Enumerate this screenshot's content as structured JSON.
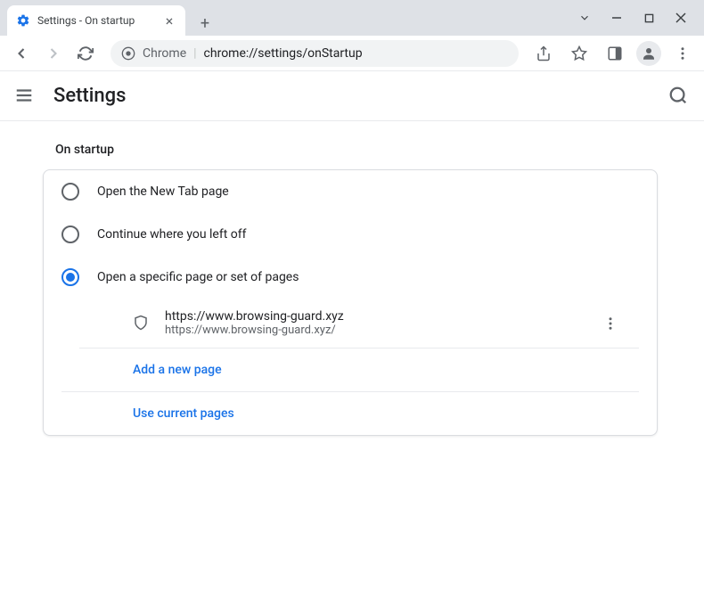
{
  "window": {
    "tab_title": "Settings - On startup"
  },
  "omnibox": {
    "scheme_label": "Chrome",
    "url": "chrome://settings/onStartup"
  },
  "header": {
    "title": "Settings"
  },
  "section": {
    "label": "On startup"
  },
  "options": [
    {
      "label": "Open the New Tab page",
      "selected": false
    },
    {
      "label": "Continue where you left off",
      "selected": false
    },
    {
      "label": "Open a specific page or set of pages",
      "selected": true
    }
  ],
  "startup_pages": [
    {
      "title": "https://www.browsing-guard.xyz",
      "url": "https://www.browsing-guard.xyz/"
    }
  ],
  "actions": {
    "add_page": "Add a new page",
    "use_current": "Use current pages"
  }
}
